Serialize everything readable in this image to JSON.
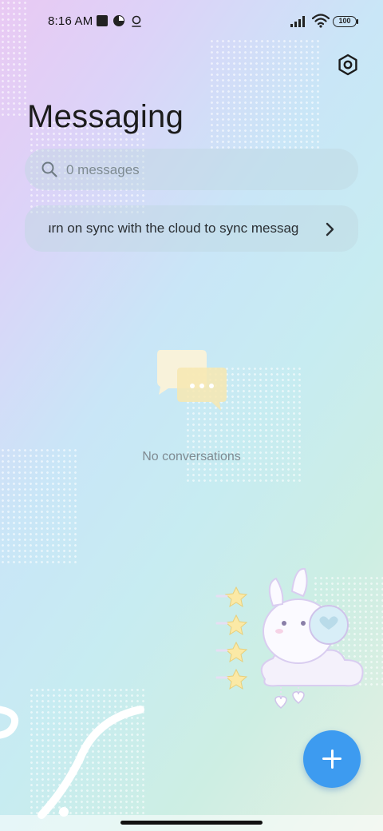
{
  "status_bar": {
    "time": "8:16 AM",
    "battery": "100",
    "icons": [
      "notification-square-icon",
      "pie-app-icon",
      "location-pin-icon",
      "signal-icon",
      "wifi-icon",
      "battery-icon"
    ]
  },
  "header": {
    "title": "Messaging",
    "settings_icon": "gear-icon"
  },
  "search": {
    "placeholder": "0 messages",
    "icon": "search-icon"
  },
  "sync_banner": {
    "text": "urn on sync with the cloud to sync messag",
    "icon": "chevron-right-icon"
  },
  "empty_state": {
    "icon": "chat-bubbles-icon",
    "text": "No conversations"
  },
  "fab": {
    "icon": "plus-icon",
    "color": "#3d9bf0"
  },
  "colors": {
    "accent": "#3d9bf0",
    "muted_text": "#7f8a91"
  }
}
